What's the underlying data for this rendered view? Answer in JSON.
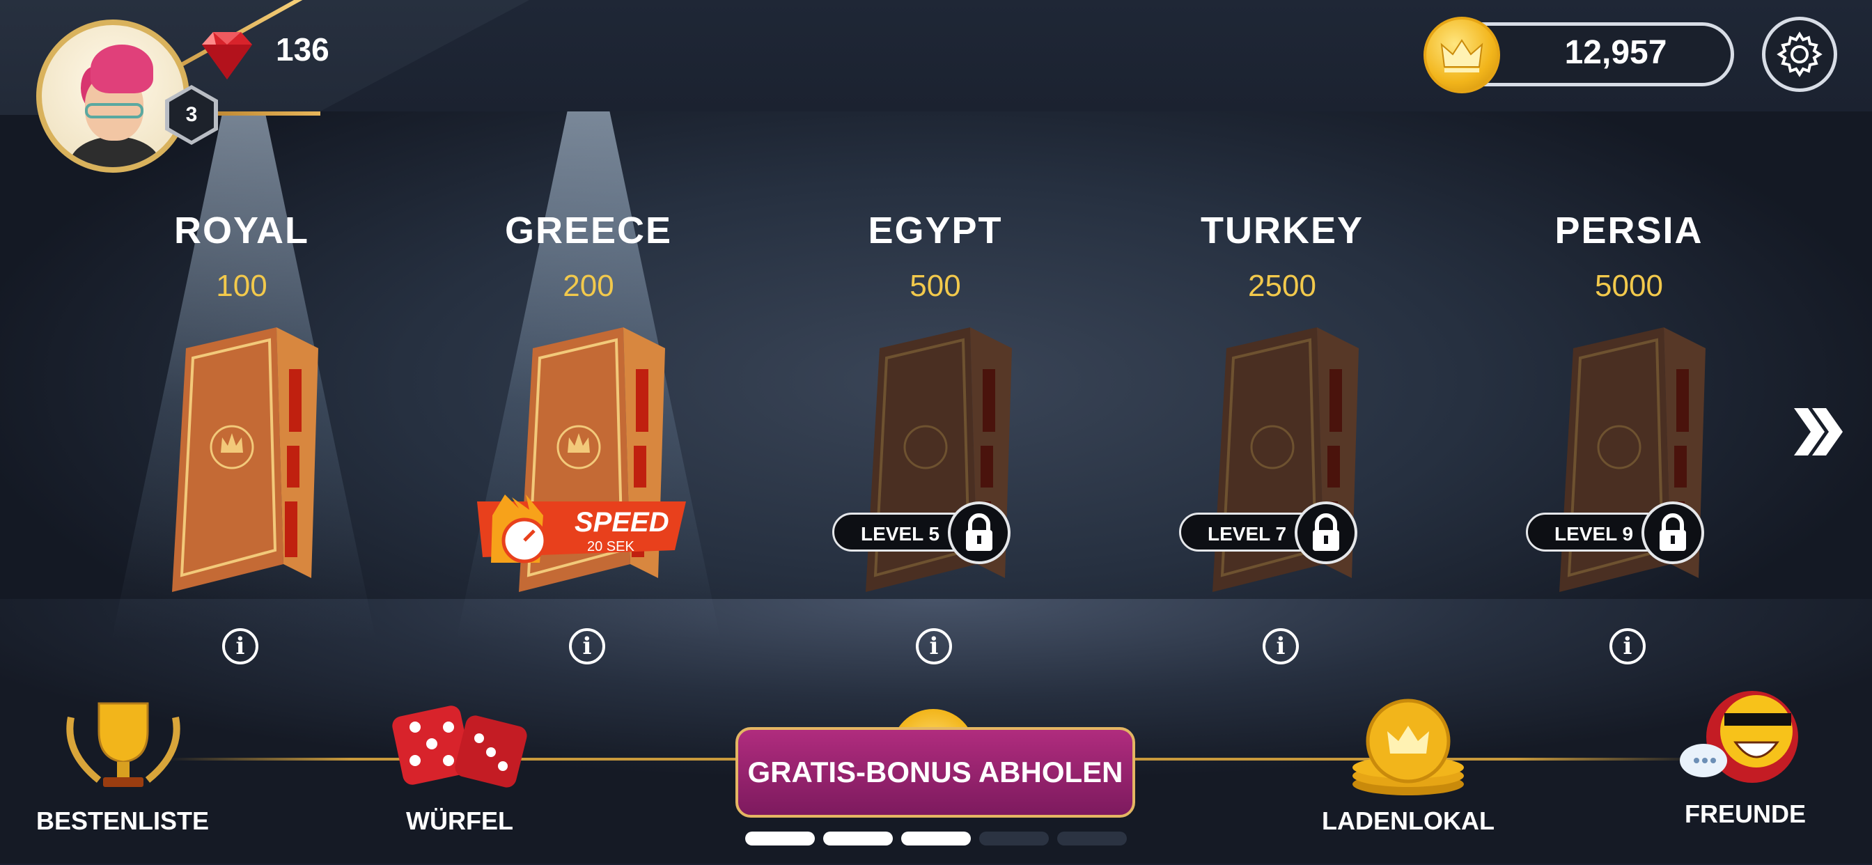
{
  "player": {
    "gems": "136",
    "level": "3",
    "coins": "12,957"
  },
  "decks": [
    {
      "name": "ROYAL",
      "price": "100",
      "locked": false,
      "badge": null
    },
    {
      "name": "GREECE",
      "price": "200",
      "locked": false,
      "badge": {
        "title": "SPEED",
        "subtitle": "20 SEK"
      }
    },
    {
      "name": "EGYPT",
      "price": "500",
      "locked": true,
      "lock_label": "LEVEL 5"
    },
    {
      "name": "TURKEY",
      "price": "2500",
      "locked": true,
      "lock_label": "LEVEL 7"
    },
    {
      "name": "PERSIA",
      "price": "5000",
      "locked": true,
      "lock_label": "LEVEL 9"
    }
  ],
  "info_symbol": "i",
  "nav": {
    "leaderboard": "BESTENLISTE",
    "dice": "WÜRFEL",
    "bonus_button": "GRATIS-BONUS ABHOLEN",
    "shop": "LADENLOKAL",
    "friends": "FREUNDE"
  },
  "pager": {
    "pages": 5,
    "active_pages": 3
  },
  "colors": {
    "accent_gold": "#f2c94c",
    "bonus_purple": "#b02c7e",
    "frame_gold": "#d9b25c"
  },
  "icons": [
    "gem-icon",
    "coin-crown-icon",
    "gear-icon",
    "lock-icon",
    "info-icon",
    "chevron-double-right-icon",
    "trophy-icon",
    "dice-icon",
    "coin-stack-icon",
    "laughing-emoji-icon"
  ]
}
